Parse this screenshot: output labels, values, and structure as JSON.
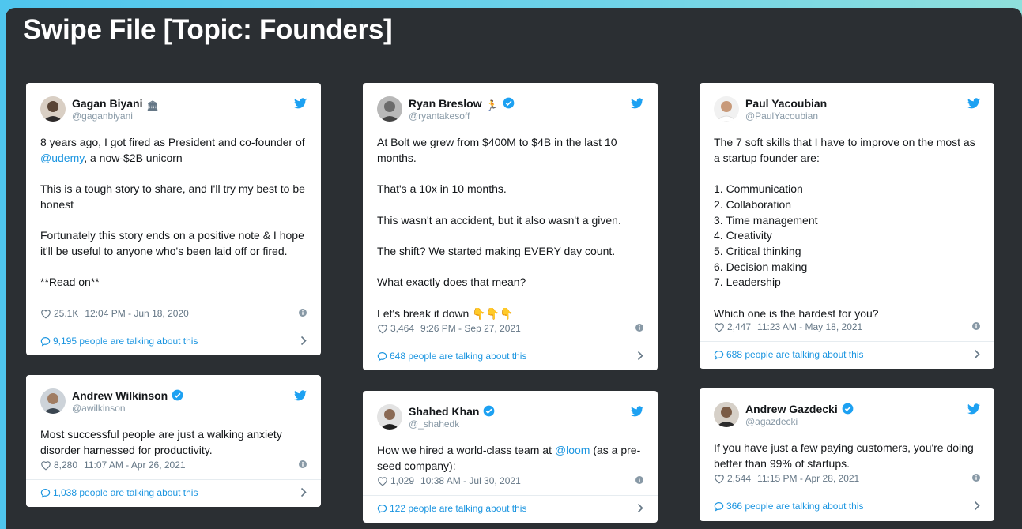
{
  "board": {
    "title": "Swipe File [Topic: Founders]"
  },
  "colors": {
    "accent": "#1b95e0",
    "board": "#2b2f33",
    "verified": "#1da1f2"
  },
  "tweets": [
    {
      "name": "Gagan Biyani",
      "badge": "🏛",
      "verified": false,
      "handle": "@gaganbiyani",
      "body_before": "8 years ago, I got fired as President and co-founder of ",
      "mention": "@udemy",
      "body_after": ", a now-$2B unicorn\n\nThis is a tough story to share, and I'll try my best to be honest\n\nFortunately this story ends on a positive note & I hope it'll be useful to anyone who's been laid off or fired.\n\n**Read on**",
      "likes": "25.1K",
      "timestamp": "12:04 PM - Jun 18, 2020",
      "talking": "9,195 people are talking about this"
    },
    {
      "name": "Andrew Wilkinson",
      "badge": "",
      "verified": true,
      "handle": "@awilkinson",
      "body_before": "Most successful people are just a walking anxiety disorder harnessed for productivity.",
      "mention": "",
      "body_after": "",
      "likes": "8,280",
      "timestamp": "11:07 AM - Apr 26, 2021",
      "talking": "1,038 people are talking about this"
    },
    {
      "name": "Ryan Breslow",
      "badge": "🏃",
      "verified": true,
      "handle": "@ryantakesoff",
      "body_before": "At Bolt we grew from $400M to $4B in the last 10 months.\n\nThat's a 10x in 10 months.\n\nThis wasn't an accident, but it also wasn't a given.\n\nThe shift? We started making EVERY day count.\n\nWhat exactly does that mean?\n\nLet's break it down 👇👇👇",
      "mention": "",
      "body_after": "",
      "likes": "3,464",
      "timestamp": "9:26 PM - Sep 27, 2021",
      "talking": "648 people are talking about this"
    },
    {
      "name": "Shahed Khan",
      "badge": "",
      "verified": true,
      "handle": "@_shahedk",
      "body_before": "How we hired a world-class team at ",
      "mention": "@loom",
      "body_after": " (as a pre-seed company):",
      "likes": "1,029",
      "timestamp": "10:38 AM - Jul 30, 2021",
      "talking": "122 people are talking about this"
    },
    {
      "name": "Paul Yacoubian",
      "badge": "",
      "verified": false,
      "handle": "@PaulYacoubian",
      "body_before": "The 7 soft skills that I have to improve on the most as a startup founder are:\n\n1. Communication\n2. Collaboration\n3. Time management\n4. Creativity\n5. Critical thinking\n6. Decision making\n7. Leadership\n\nWhich one is the hardest for you?",
      "mention": "",
      "body_after": "",
      "likes": "2,447",
      "timestamp": "11:23 AM - May 18, 2021",
      "talking": "688 people are talking about this"
    },
    {
      "name": "Andrew Gazdecki",
      "badge": "",
      "verified": true,
      "handle": "@agazdecki",
      "body_before": "If you have just a few paying customers, you're doing better than 99% of startups.",
      "mention": "",
      "body_after": "",
      "likes": "2,544",
      "timestamp": "11:15 PM - Apr 28, 2021",
      "talking": "366 people are talking about this"
    }
  ]
}
